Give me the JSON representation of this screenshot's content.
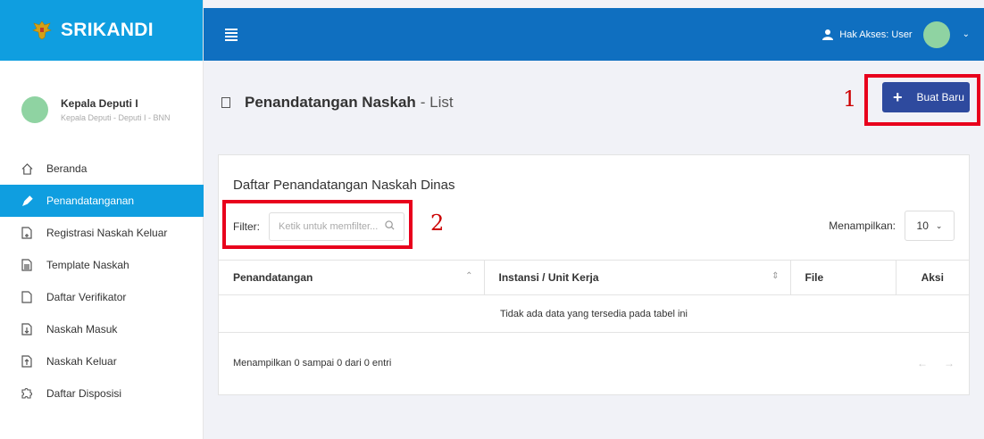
{
  "brand": {
    "name": "SRIKANDI"
  },
  "profile": {
    "name": "Kepala Deputi I",
    "role": "Kepala Deputi - Deputi I - BNN"
  },
  "sidebar": {
    "items": [
      {
        "label": "Beranda",
        "icon": "home-icon",
        "active": false
      },
      {
        "label": "Penandatanganan",
        "icon": "pen-icon",
        "active": true
      },
      {
        "label": "Registrasi Naskah Keluar",
        "icon": "file-plus-icon",
        "active": false
      },
      {
        "label": "Template Naskah",
        "icon": "document-icon",
        "active": false
      },
      {
        "label": "Daftar Verifikator",
        "icon": "file-check-icon",
        "active": false
      },
      {
        "label": "Naskah Masuk",
        "icon": "file-in-icon",
        "active": false
      },
      {
        "label": "Naskah Keluar",
        "icon": "file-out-icon",
        "active": false
      },
      {
        "label": "Daftar Disposisi",
        "icon": "puzzle-icon",
        "active": false
      }
    ]
  },
  "topbar": {
    "access_label": "Hak Akses: User"
  },
  "page": {
    "title_bold": "Penandatangan Naskah",
    "title_rest": "- List",
    "new_button": "Buat Baru"
  },
  "card": {
    "title": "Daftar Penandatangan Naskah Dinas",
    "filter_label": "Filter:",
    "filter_placeholder": "Ketik untuk memfilter...",
    "display_label": "Menampilkan:",
    "display_value": "10",
    "columns": [
      "Penandatangan",
      "Instansi / Unit Kerja",
      "File",
      "Aksi"
    ],
    "empty_message": "Tidak ada data yang tersedia pada tabel ini",
    "footer_info": "Menampilkan 0 sampai 0 dari 0 entri"
  },
  "annotations": {
    "box1": "1",
    "box2": "2"
  },
  "colors": {
    "brand": "#0f9ee0",
    "topbar": "#0f6fc0",
    "primary_button": "#2e4a9e",
    "annotation": "#e8001c"
  }
}
